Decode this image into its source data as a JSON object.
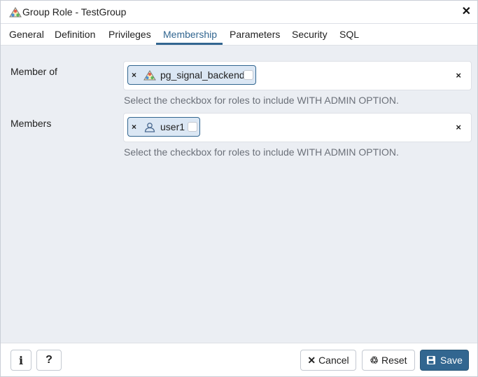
{
  "dialog": {
    "title": "Group Role - TestGroup",
    "title_icon": "group-role-icon",
    "close_label": "✕"
  },
  "tabs": [
    {
      "label": "General",
      "active": false
    },
    {
      "label": "Definition",
      "active": false
    },
    {
      "label": "Privileges",
      "active": false
    },
    {
      "label": "Membership",
      "active": true
    },
    {
      "label": "Parameters",
      "active": false
    },
    {
      "label": "Security",
      "active": false
    },
    {
      "label": "SQL",
      "active": false
    }
  ],
  "member_of": {
    "label": "Member of",
    "chips": [
      {
        "label": "pg_signal_backend",
        "icon": "group-role-icon",
        "remove": "×",
        "admin_option": false
      }
    ],
    "clear": "×",
    "help": "Select the checkbox for roles to include WITH ADMIN OPTION."
  },
  "members": {
    "label": "Members",
    "chips": [
      {
        "label": "user1",
        "icon": "user-role-icon",
        "remove": "×",
        "admin_option": false
      }
    ],
    "clear": "×",
    "help": "Select the checkbox for roles to include WITH ADMIN OPTION."
  },
  "footer": {
    "info_label": "i",
    "help_label": "?",
    "cancel_label": "Cancel",
    "reset_label": "Reset",
    "save_label": "Save"
  },
  "colors": {
    "accent": "#326690",
    "chip_background": "#dbe7f4",
    "content_background": "#ebeef3",
    "help_text": "#6b7079"
  }
}
